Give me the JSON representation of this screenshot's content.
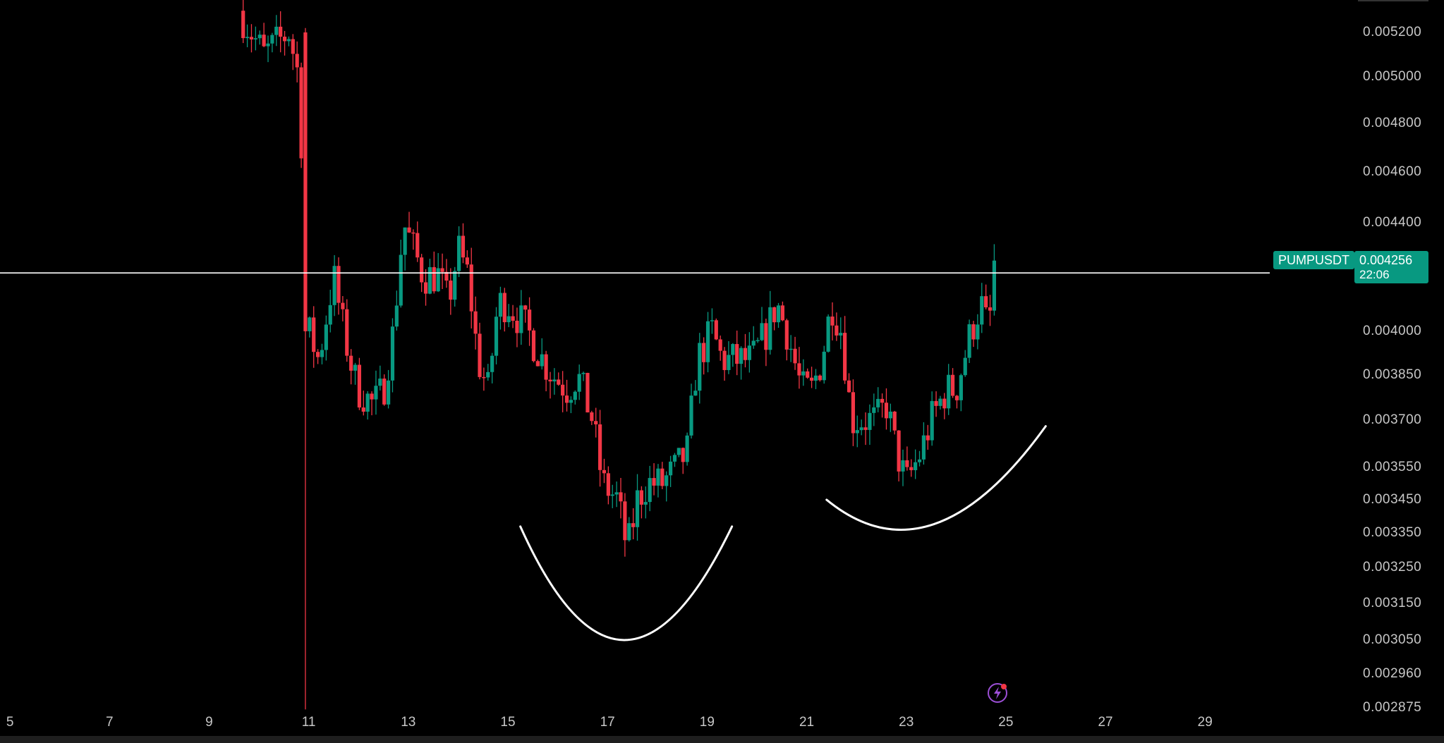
{
  "chart_data": {
    "type": "candlestick",
    "symbol": "PUMPUSDT",
    "last_price": "0.004256",
    "countdown": "22:06",
    "horizontal_line": 0.00421,
    "x_ticks": [
      "5",
      "7",
      "9",
      "11",
      "13",
      "15",
      "17",
      "19",
      "21",
      "23",
      "25",
      "27",
      "29"
    ],
    "x_tick_days": [
      5,
      7,
      9,
      11,
      13,
      15,
      17,
      19,
      21,
      23,
      25,
      27,
      29
    ],
    "y_ticks": [
      "0.005200",
      "0.005000",
      "0.004800",
      "0.004600",
      "0.004400",
      "0.004000",
      "0.003850",
      "0.003700",
      "0.003550",
      "0.003450",
      "0.003350",
      "0.003250",
      "0.003150",
      "0.003050",
      "0.002960",
      "0.002875"
    ],
    "y_tick_values": [
      0.0052,
      0.005,
      0.0048,
      0.0046,
      0.0044,
      0.004,
      0.00385,
      0.0037,
      0.00355,
      0.00345,
      0.00335,
      0.00325,
      0.00315,
      0.00305,
      0.00296,
      0.002875
    ],
    "scale": "log",
    "x_range": [
      4.8,
      32.0
    ],
    "price_range": [
      0.00286,
      0.00535
    ],
    "colors": {
      "up": "#089981",
      "down": "#f23645",
      "line": "#ffffff",
      "badge": "#089981"
    },
    "anchors": [
      [
        9.6,
        0.0053
      ],
      [
        10.1,
        0.0051
      ],
      [
        10.6,
        0.0052
      ],
      [
        10.8,
        0.005
      ],
      [
        11.0,
        0.004
      ],
      [
        11.2,
        0.0039
      ],
      [
        11.5,
        0.0042
      ],
      [
        11.7,
        0.004
      ],
      [
        11.9,
        0.00385
      ],
      [
        12.0,
        0.0038
      ],
      [
        12.3,
        0.00375
      ],
      [
        12.5,
        0.0038
      ],
      [
        12.7,
        0.004
      ],
      [
        12.9,
        0.0044
      ],
      [
        13.1,
        0.0043
      ],
      [
        13.3,
        0.0042
      ],
      [
        13.6,
        0.0042
      ],
      [
        13.8,
        0.0041
      ],
      [
        14.0,
        0.0043
      ],
      [
        14.2,
        0.0042
      ],
      [
        14.4,
        0.0039
      ],
      [
        14.6,
        0.0038
      ],
      [
        14.8,
        0.0041
      ],
      [
        15.0,
        0.0041
      ],
      [
        15.4,
        0.004
      ],
      [
        15.7,
        0.0039
      ],
      [
        15.9,
        0.00385
      ],
      [
        16.2,
        0.0038
      ],
      [
        16.4,
        0.00385
      ],
      [
        16.7,
        0.0037
      ],
      [
        16.9,
        0.0035
      ],
      [
        17.2,
        0.00345
      ],
      [
        17.4,
        0.0033
      ],
      [
        17.6,
        0.00345
      ],
      [
        17.8,
        0.0035
      ],
      [
        18.1,
        0.0035
      ],
      [
        18.4,
        0.00355
      ],
      [
        18.6,
        0.0036
      ],
      [
        18.8,
        0.0039
      ],
      [
        19.1,
        0.004
      ],
      [
        19.3,
        0.0039
      ],
      [
        19.6,
        0.0039
      ],
      [
        19.9,
        0.0039
      ],
      [
        20.2,
        0.004
      ],
      [
        20.4,
        0.0041
      ],
      [
        20.6,
        0.004
      ],
      [
        20.9,
        0.0038
      ],
      [
        21.1,
        0.0038
      ],
      [
        21.3,
        0.0039
      ],
      [
        21.5,
        0.0041
      ],
      [
        21.7,
        0.004
      ],
      [
        21.9,
        0.0037
      ],
      [
        22.1,
        0.0037
      ],
      [
        22.4,
        0.0037
      ],
      [
        22.6,
        0.00375
      ],
      [
        22.8,
        0.0036
      ],
      [
        23.0,
        0.0035
      ],
      [
        23.3,
        0.0036
      ],
      [
        23.5,
        0.0037
      ],
      [
        23.8,
        0.0038
      ],
      [
        24.0,
        0.0038
      ],
      [
        24.3,
        0.004
      ],
      [
        24.5,
        0.0041
      ],
      [
        24.65,
        0.004
      ],
      [
        24.8,
        0.004256
      ]
    ],
    "annotations": {
      "curve1": [
        [
          15.25,
          0.00337
        ],
        [
          17.3,
          0.00283
        ],
        [
          19.5,
          0.00337
        ]
      ],
      "curve2": [
        [
          21.4,
          0.00345
        ],
        [
          23.5,
          0.00328
        ],
        [
          25.8,
          0.00368
        ]
      ]
    }
  }
}
